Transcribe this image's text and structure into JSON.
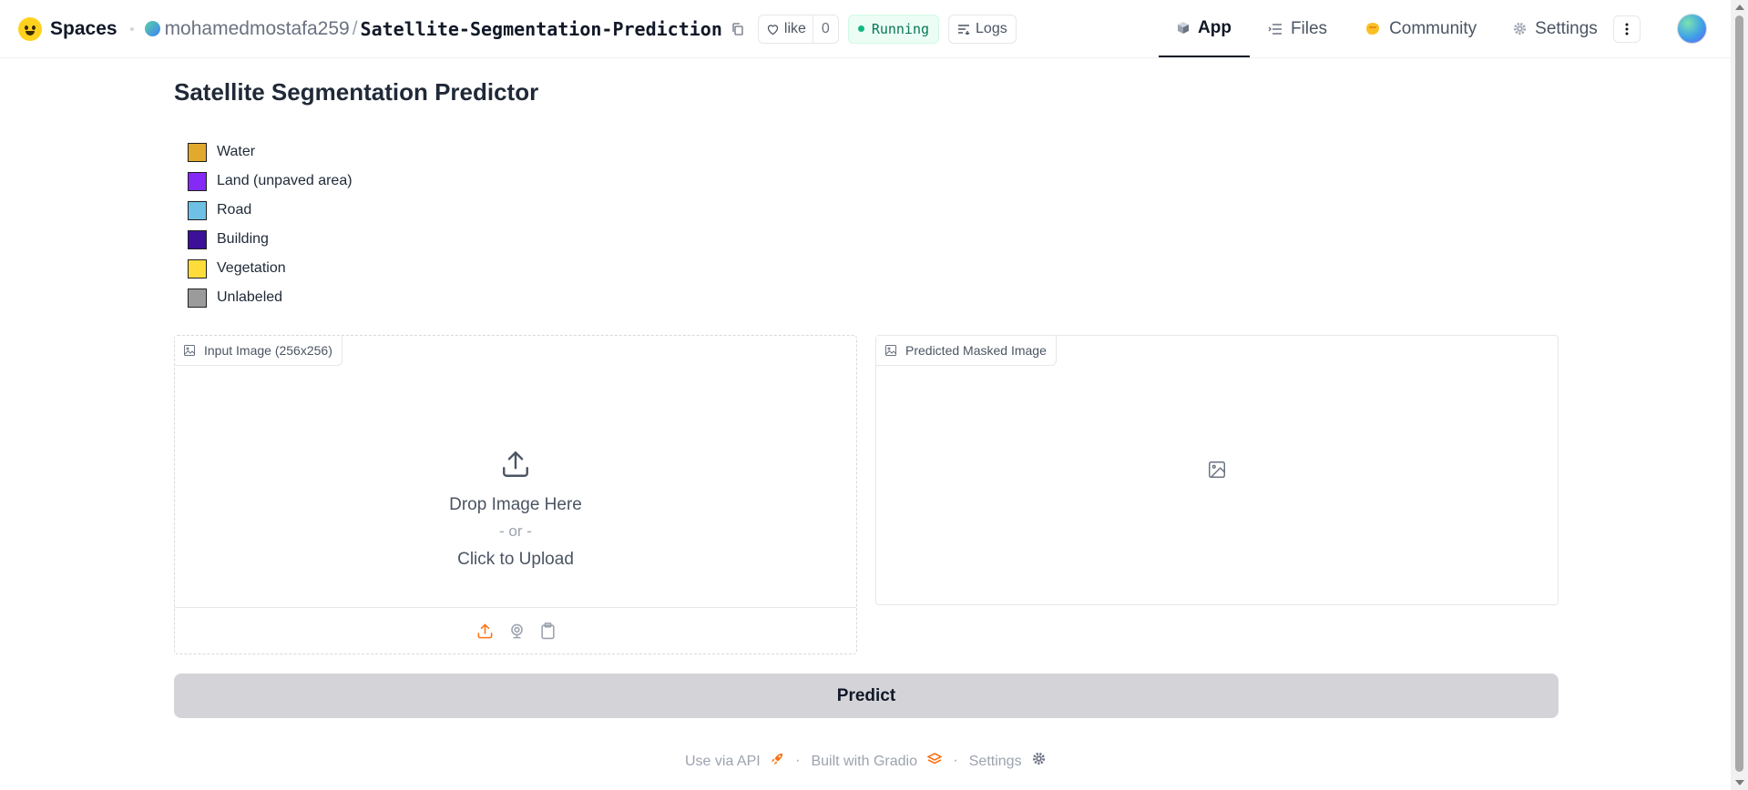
{
  "header": {
    "brand": "Spaces",
    "owner": "mohamedmostafa259",
    "separator": "/",
    "repo": "Satellite-Segmentation-Prediction",
    "like_label": "like",
    "like_count": "0",
    "status": "Running",
    "logs_label": "Logs",
    "nav": {
      "app": "App",
      "files": "Files",
      "community": "Community",
      "settings": "Settings"
    }
  },
  "main": {
    "title": "Satellite Segmentation Predictor",
    "legend": [
      {
        "label": "Water",
        "color": "#E2A92F"
      },
      {
        "label": "Land (unpaved area)",
        "color": "#8429F6"
      },
      {
        "label": "Road",
        "color": "#6EC1E4"
      },
      {
        "label": "Building",
        "color": "#3C1098"
      },
      {
        "label": "Vegetation",
        "color": "#FEDD3A"
      },
      {
        "label": "Unlabeled",
        "color": "#9B9B9B"
      }
    ],
    "input_panel": {
      "label": "Input Image (256x256)",
      "drop_text": "Drop Image Here",
      "or_text": "- or -",
      "click_text": "Click to Upload"
    },
    "output_panel": {
      "label": "Predicted Masked Image"
    },
    "predict_label": "Predict"
  },
  "footer": {
    "api": "Use via API",
    "built": "Built with Gradio",
    "settings": "Settings",
    "separator": "·"
  },
  "colors": {
    "accent_orange": "#f97316",
    "status_green": "#10b981",
    "button_gray": "#d4d4d8"
  }
}
